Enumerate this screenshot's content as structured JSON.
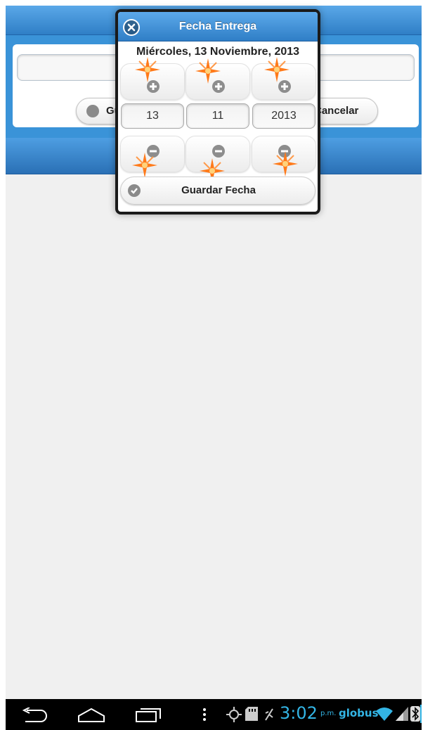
{
  "app": {
    "save_label": "Guardar",
    "cancel_label": "Cancelar"
  },
  "dialog": {
    "title": "Fecha Entrega",
    "date_text": "Miércoles, 13 Noviembre, 2013",
    "day": "13",
    "month": "11",
    "year": "2013",
    "save_button": "Guardar Fecha"
  },
  "statusbar": {
    "time": "3:02",
    "ampm": "p.m.",
    "carrier": "globus"
  },
  "colors": {
    "header_blue": "#3a93d8",
    "status_blue": "#33b5e5",
    "icon_gray": "#8d8d8d"
  },
  "icons": [
    "close-icon",
    "plus-icon",
    "minus-icon",
    "check-icon",
    "back-icon",
    "home-icon",
    "recents-icon",
    "menu-icon",
    "gps-icon",
    "sd-card-icon",
    "usb-icon",
    "wifi-icon",
    "signal-icon",
    "bluetooth-icon"
  ]
}
